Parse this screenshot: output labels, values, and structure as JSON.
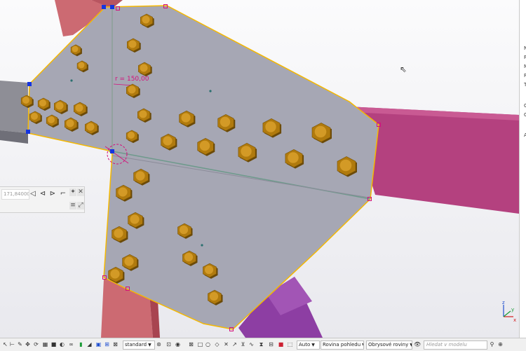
{
  "viewport": {
    "dimension_label": "r = 150,00",
    "background_top": "#fbfbfc",
    "background_bottom": "#e9e9ee",
    "colors": {
      "plate": "#a6a7b4",
      "plate_outline": "#f5b800",
      "beam_red": "#cc6a72",
      "beam_magenta": "#b4417f",
      "beam_grey": "#8e8e96",
      "bolt": "#b07a0d",
      "handle": "#1535e0",
      "dimension": "#d4107a"
    },
    "cursor": "pointer-arrow"
  },
  "right_panel_letters": [
    "N",
    "F",
    "M",
    "F",
    "T",
    "C",
    "C",
    "A"
  ],
  "floating_toolbar": {
    "angle_value": "171,84000°",
    "icons": [
      "align-left-icon",
      "align-center-icon",
      "align-right-icon",
      "corner-icon",
      "pin-icon",
      "close-icon",
      "list-icon",
      "expand-icon"
    ]
  },
  "axis": {
    "z": "z",
    "y": "y",
    "x": "x"
  },
  "statusbar": {
    "icons_left": [
      "select-icon",
      "snap-icon",
      "pencil-icon",
      "move-icon",
      "rotate-icon",
      "grid-icon",
      "render-icon",
      "view-icon",
      "link-icon",
      "paint-icon",
      "shape-icon",
      "layers-icon",
      "filter-icon",
      "component-icon",
      "clip-icon",
      "sync-icon"
    ],
    "standard_label": "standard",
    "icons_mid": [
      "snap-point-icon",
      "snap-line-icon",
      "eye-icon",
      "box-icon",
      "square-icon",
      "circle-icon",
      "diamond-icon",
      "cross-icon",
      "arrow-icon",
      "merge-icon",
      "wave-icon",
      "hourglass-icon",
      "frame-icon",
      "stop-icon",
      "cube-icon"
    ],
    "auto_label": "Auto",
    "plane_label": "Rovina pohledu",
    "outline_label": "Obrysové roviny",
    "eye_icon": "visibility-icon",
    "search_placeholder": "Hledat v modelu",
    "icons_right": [
      "search-icon",
      "zoom-icon"
    ]
  }
}
